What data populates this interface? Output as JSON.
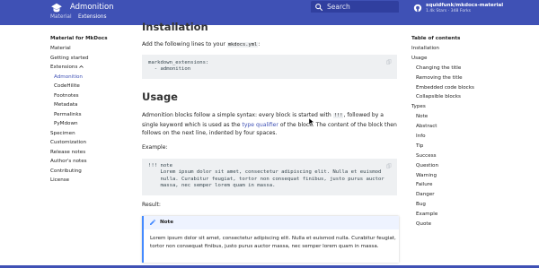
{
  "header": {
    "title": "Admonition",
    "search_placeholder": "Search",
    "repo_name": "squidfunk/mkdocs-material",
    "repo_stats": "1.4k Stars · 348 Forks",
    "tabs": [
      {
        "label": "Material"
      },
      {
        "label": "Extensions"
      }
    ],
    "colors": {
      "primary": "#3f51b5",
      "search_bg": "#303f9f"
    }
  },
  "nav": {
    "title": "Material for MkDocs",
    "items": [
      {
        "label": "Material"
      },
      {
        "label": "Getting started"
      },
      {
        "label": "Extensions"
      },
      {
        "label": "Admonition"
      },
      {
        "label": "CodeHilite"
      },
      {
        "label": "Footnotes"
      },
      {
        "label": "Metadata"
      },
      {
        "label": "Permalinks"
      },
      {
        "label": "PyMdown"
      },
      {
        "label": "Specimen"
      },
      {
        "label": "Customization"
      },
      {
        "label": "Release notes"
      },
      {
        "label": "Author's notes"
      },
      {
        "label": "Contributing"
      },
      {
        "label": "License"
      }
    ]
  },
  "content": {
    "installation_heading": "Installation",
    "install_text_before": "Add the following lines to your ",
    "install_code": "mkdocs.yml",
    "install_text_after": ":",
    "install_codeblock": "markdown_extensions:\n  - admonition",
    "usage_heading": "Usage",
    "usage_p1_a": "Admonition blocks follow a simple syntax: every block is started with ",
    "usage_p1_code": "!!!",
    "usage_p1_b": ", followed by a single keyword which is used as the ",
    "usage_p1_link": "type qualifier",
    "usage_p1_c": " of the block. The content of the block then follows on the next line, indented by four spaces.",
    "example_label": "Example:",
    "example_codeblock": "!!! note\n    Lorem ipsum dolor sit amet, consectetur adipiscing elit. Nulla et euismod\n    nulla. Curabitur feugiat, tortor non consequat finibus, justo purus auctor\n    massa, nec semper lorem quam in massa.",
    "result_label": "Result:",
    "admonition": {
      "title": "Note",
      "body": "Lorem ipsum dolor sit amet, consectetur adipiscing elit. Nulla et euismod nulla. Curabitur feugiat, tortor non consequat finibus, justo purus auctor massa, nec semper lorem quam in massa.",
      "accent": "#448aff"
    }
  },
  "toc": {
    "title": "Table of contents",
    "items": [
      {
        "label": "Installation"
      },
      {
        "label": "Usage"
      },
      {
        "label": "Changing the title"
      },
      {
        "label": "Removing the title"
      },
      {
        "label": "Embedded code blocks"
      },
      {
        "label": "Collapsible blocks"
      },
      {
        "label": "Types"
      },
      {
        "label": "Note"
      },
      {
        "label": "Abstract"
      },
      {
        "label": "Info"
      },
      {
        "label": "Tip"
      },
      {
        "label": "Success"
      },
      {
        "label": "Question"
      },
      {
        "label": "Warning"
      },
      {
        "label": "Failure"
      },
      {
        "label": "Danger"
      },
      {
        "label": "Bug"
      },
      {
        "label": "Example"
      },
      {
        "label": "Quote"
      }
    ]
  }
}
